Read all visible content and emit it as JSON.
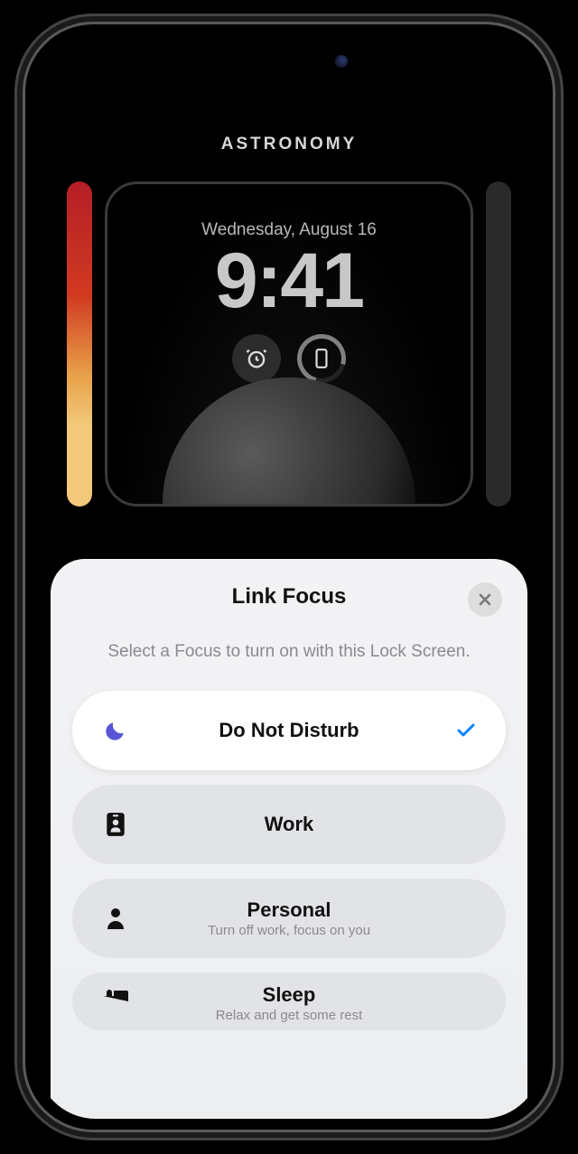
{
  "gallery": {
    "title": "ASTRONOMY",
    "date": "Wednesday, August 16",
    "time": "9:41"
  },
  "sheet": {
    "title": "Link Focus",
    "description": "Select a Focus to turn on with this Lock Screen.",
    "options": [
      {
        "label": "Do Not Disturb",
        "sub": "",
        "selected": true,
        "icon": "moon"
      },
      {
        "label": "Work",
        "sub": "",
        "selected": false,
        "icon": "badge"
      },
      {
        "label": "Personal",
        "sub": "Turn off work, focus on you",
        "selected": false,
        "icon": "person"
      },
      {
        "label": "Sleep",
        "sub": "Relax and get some rest",
        "selected": false,
        "icon": "bed"
      }
    ]
  }
}
